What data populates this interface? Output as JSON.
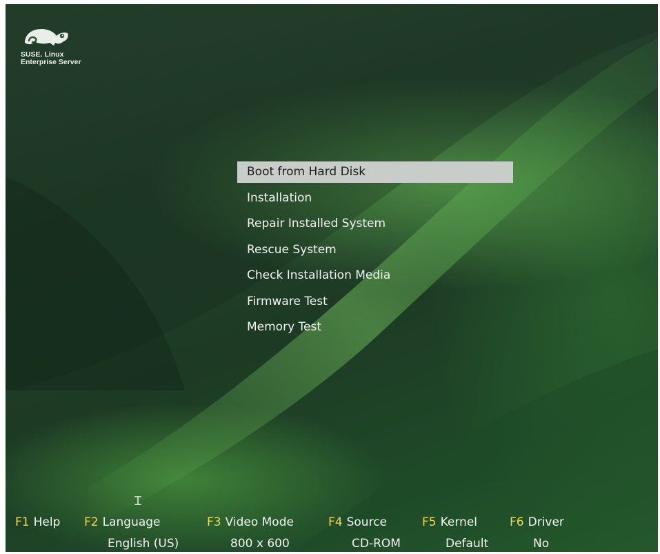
{
  "logo": {
    "brand_line1": "SUSE. Linux",
    "brand_line2": "Enterprise Server",
    "icon": "chameleon-icon"
  },
  "menu": {
    "items": [
      {
        "label": "Boot from Hard Disk",
        "selected": true
      },
      {
        "label": "Installation",
        "selected": false
      },
      {
        "label": "Repair Installed System",
        "selected": false
      },
      {
        "label": "Rescue System",
        "selected": false
      },
      {
        "label": "Check Installation Media",
        "selected": false
      },
      {
        "label": "Firmware Test",
        "selected": false
      },
      {
        "label": "Memory Test",
        "selected": false
      }
    ]
  },
  "function_keys": [
    {
      "key": "F1",
      "label": "Help",
      "value": ""
    },
    {
      "key": "F2",
      "label": "Language",
      "value": "English (US)"
    },
    {
      "key": "F3",
      "label": "Video Mode",
      "value": "800 x 600"
    },
    {
      "key": "F4",
      "label": "Source",
      "value": "CD-ROM"
    },
    {
      "key": "F5",
      "label": "Kernel",
      "value": "Default"
    },
    {
      "key": "F6",
      "label": "Driver",
      "value": "No"
    }
  ],
  "colors": {
    "fkey_accent": "#f0d64a",
    "selection_bar": "#c9cdc9",
    "text": "#f2f5f2"
  }
}
